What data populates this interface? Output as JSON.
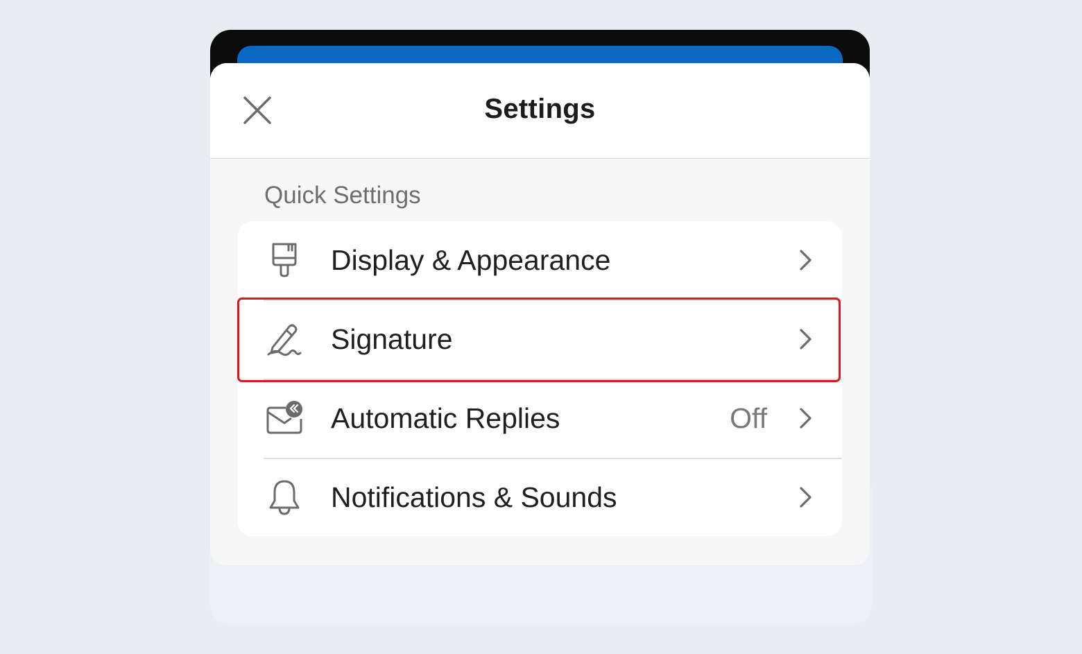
{
  "header": {
    "title": "Settings",
    "close_icon": "close-icon"
  },
  "section": {
    "label": "Quick Settings"
  },
  "items": [
    {
      "label": "Display & Appearance",
      "value": "",
      "icon": "paintbrush-icon"
    },
    {
      "label": "Signature",
      "value": "",
      "icon": "signature-pen-icon"
    },
    {
      "label": "Automatic Replies",
      "value": "Off",
      "icon": "mail-reply-icon"
    },
    {
      "label": "Notifications & Sounds",
      "value": "",
      "icon": "bell-icon"
    }
  ],
  "colors": {
    "accent_blue": "#0868c4",
    "highlight_red": "#e0161c",
    "background": "#e9edf3"
  }
}
